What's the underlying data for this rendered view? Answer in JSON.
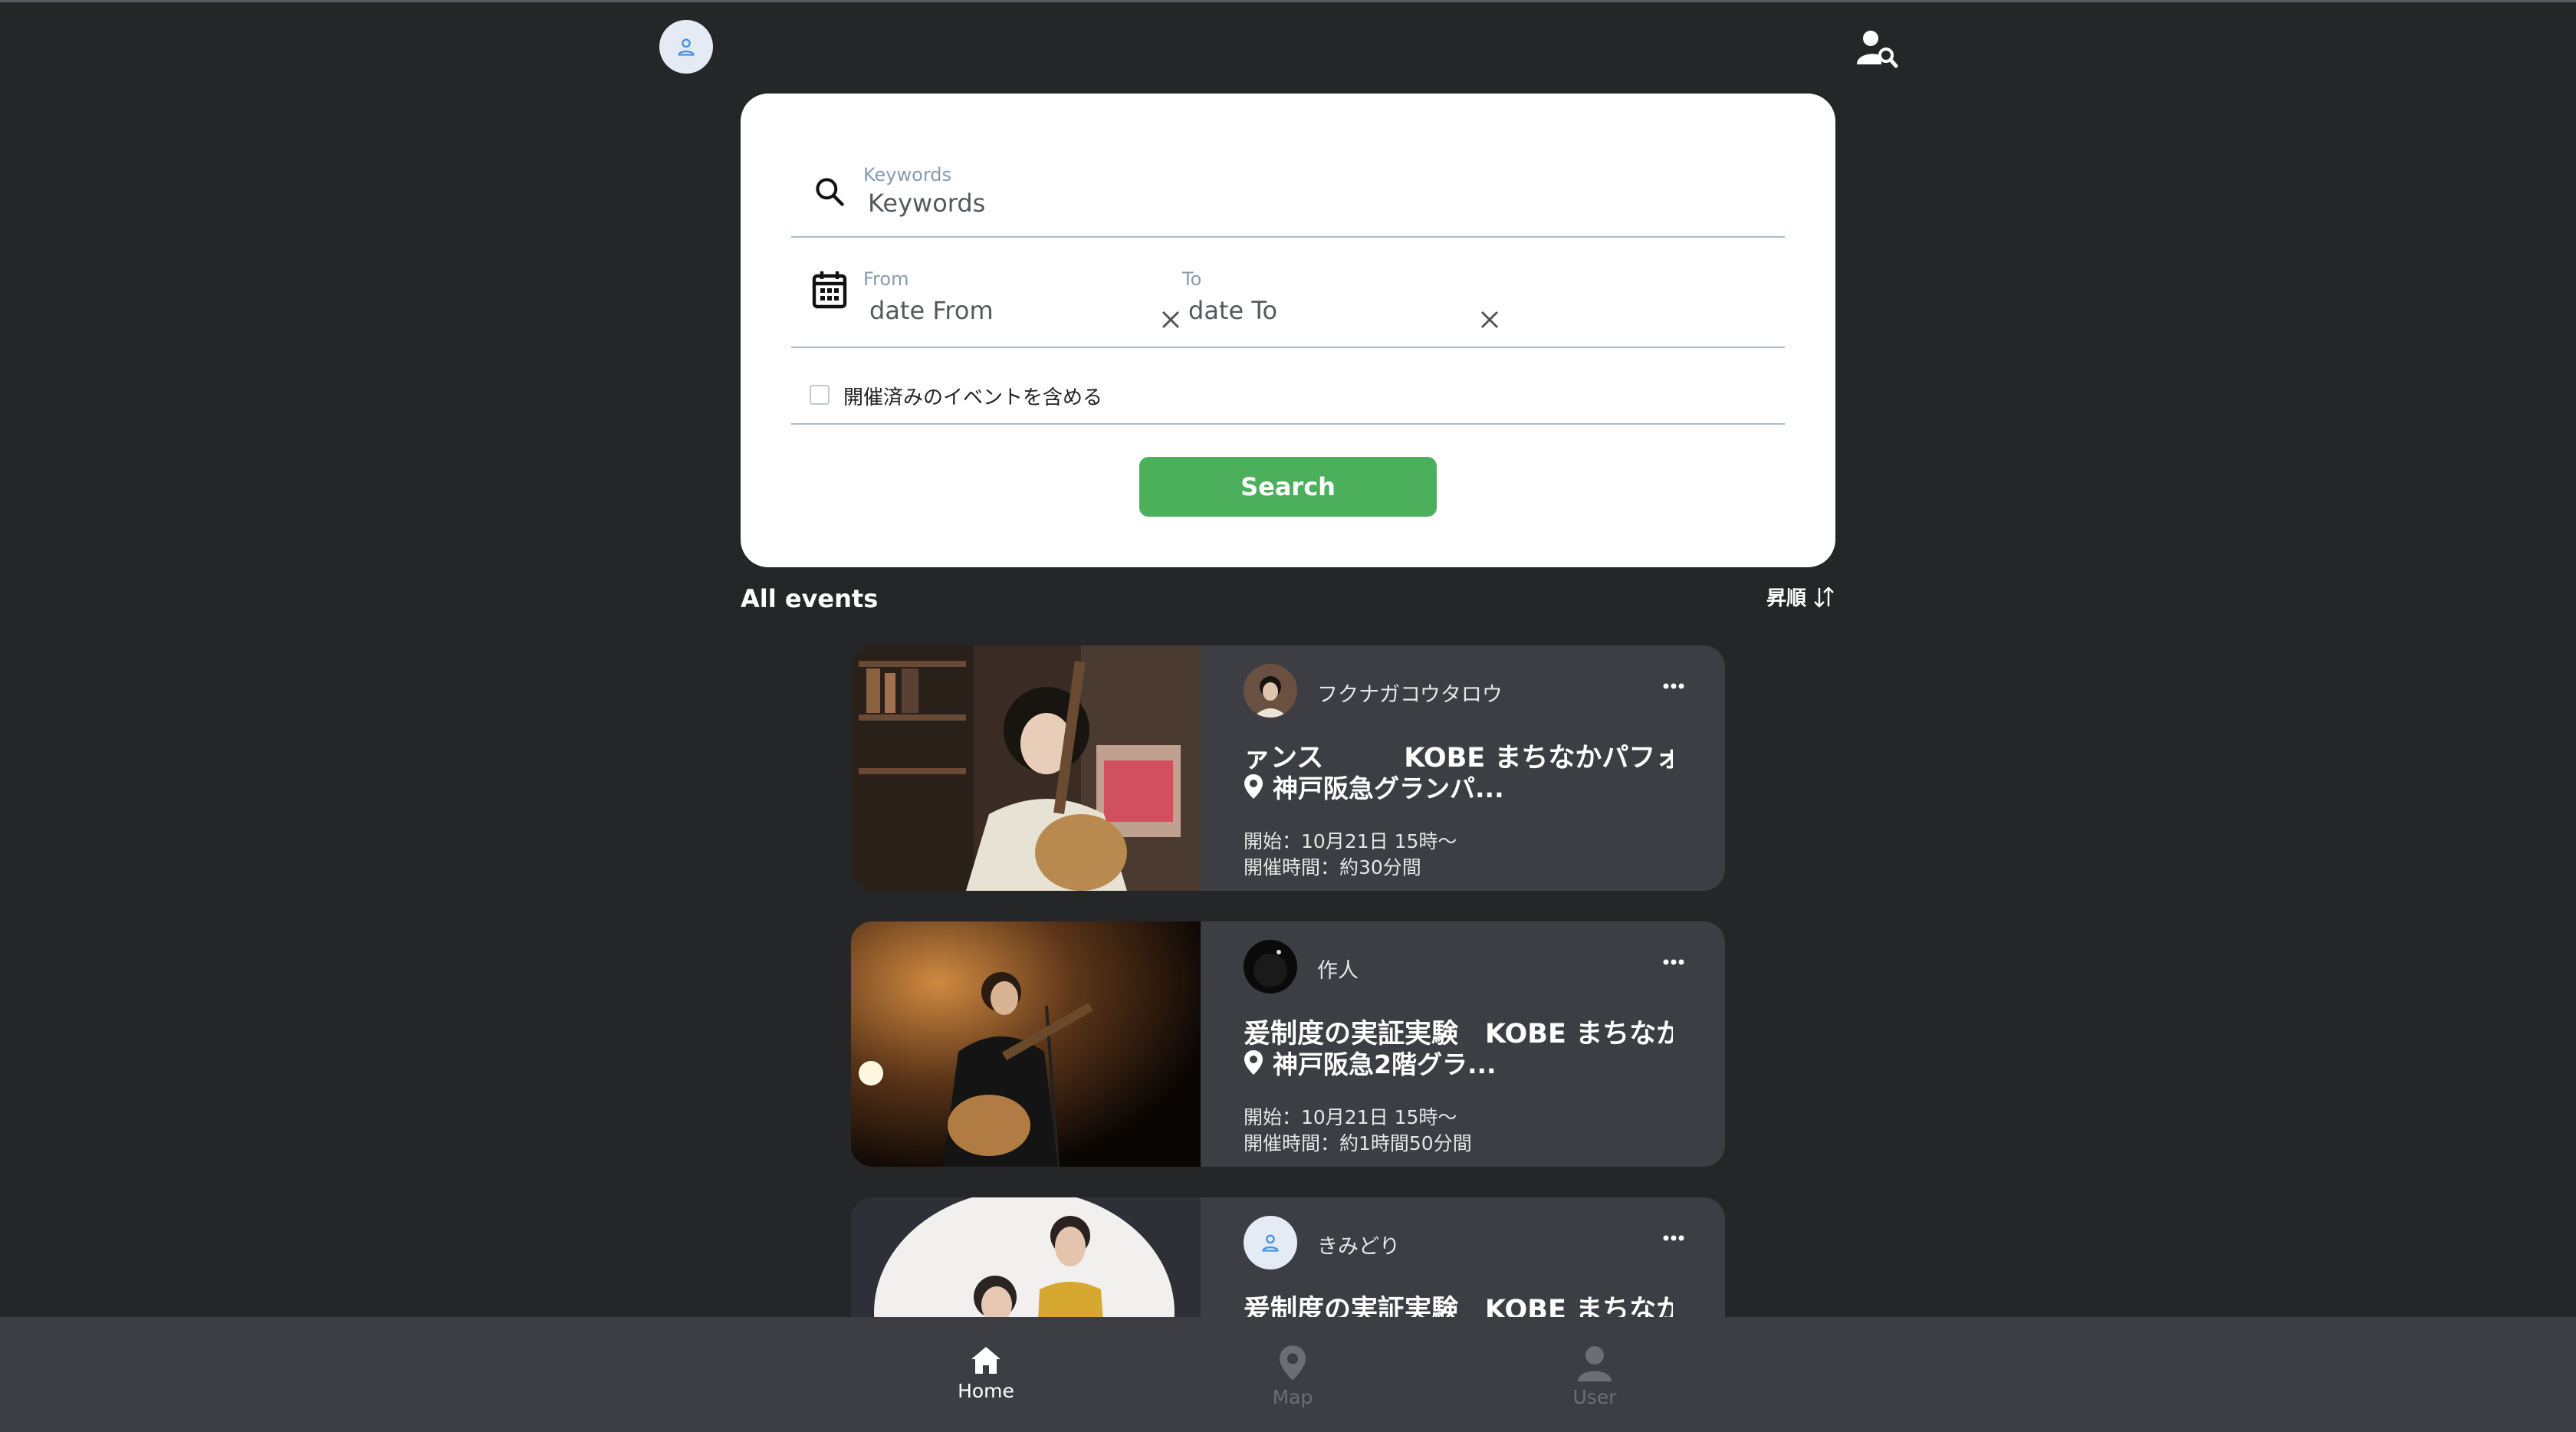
{
  "search": {
    "keywords_label": "Keywords",
    "keywords_placeholder": "Keywords",
    "from_label": "From",
    "from_placeholder": "date From",
    "to_label": "To",
    "to_placeholder": "date To",
    "include_past_label": "開催済みのイベントを含める",
    "include_past_checked": false,
    "search_button": "Search"
  },
  "list": {
    "title": "All events",
    "sort_label": "昇順"
  },
  "events": [
    {
      "organizer": "フクナガコウタロウ",
      "title": "ァンス　　　KOBE まちなかパフォーマ",
      "location": "神戸阪急グランパ...",
      "start": "開始：10月21日 15時〜",
      "duration": "開催時間：約30分間"
    },
    {
      "organizer": "作人",
      "title": "爰制度の実証実験　KOBE まちなかパフ",
      "location": "神戸阪急2階グラ...",
      "start": "開始：10月21日 15時〜",
      "duration": "開催時間：約1時間50分間"
    },
    {
      "organizer": "きみどり",
      "title": "爰制度の実証実験　KOBE まちなかパフ",
      "location": "",
      "start": "",
      "duration": ""
    }
  ],
  "nav": [
    {
      "label": "Home",
      "icon": "home-icon",
      "active": true
    },
    {
      "label": "Map",
      "icon": "map-pin-icon",
      "active": false
    },
    {
      "label": "User",
      "icon": "user-icon",
      "active": false
    }
  ],
  "colors": {
    "background": "#252628",
    "card": "#3d3e43",
    "accent_green": "#4caf5c",
    "avatar_bg": "#e4ebf5",
    "avatar_icon": "#4a8fe0"
  }
}
